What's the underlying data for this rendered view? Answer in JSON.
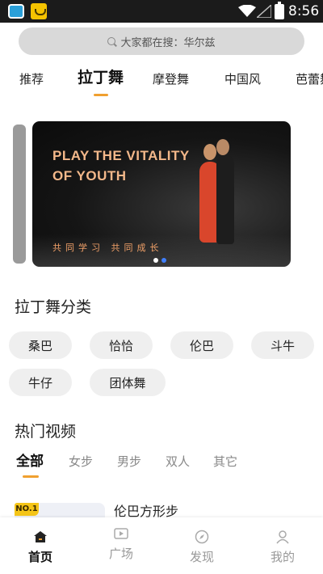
{
  "status_bar": {
    "time": "8:56",
    "icons": [
      "app-icon-blue",
      "app-icon-shopping-bag",
      "wifi-icon",
      "signal-icon",
      "battery-charging-icon"
    ]
  },
  "search": {
    "placeholder": "大家都在搜：华尔兹",
    "icon": "search-icon"
  },
  "category_tabs": [
    {
      "label": "推荐",
      "active": false
    },
    {
      "label": "拉丁舞",
      "active": true
    },
    {
      "label": "摩登舞",
      "active": false
    },
    {
      "label": "中国风",
      "active": false
    },
    {
      "label": "芭蕾舞",
      "active": false
    }
  ],
  "banner": {
    "title_line1": "PLAY THE VITALITY",
    "title_line2": "OF YOUTH",
    "subtitle": "共同学习  共同成长",
    "page_count": 2,
    "active_page": 2
  },
  "latin_categories": {
    "title": "拉丁舞分类",
    "items": [
      "桑巴",
      "恰恰",
      "伦巴",
      "斗牛",
      "牛仔",
      "团体舞"
    ]
  },
  "hot_videos": {
    "title": "热门视频",
    "tabs": [
      {
        "label": "全部",
        "active": true
      },
      {
        "label": "女步",
        "active": false
      },
      {
        "label": "男步",
        "active": false
      },
      {
        "label": "双人",
        "active": false
      },
      {
        "label": "其它",
        "active": false
      }
    ],
    "items": [
      {
        "rank_badge": "NO.1",
        "title": "伦巴方形步"
      }
    ]
  },
  "bottom_nav": [
    {
      "label": "首页",
      "icon": "home-icon",
      "active": true
    },
    {
      "label": "广场",
      "icon": "video-square-icon",
      "active": false
    },
    {
      "label": "发现",
      "icon": "compass-icon",
      "active": false
    },
    {
      "label": "我的",
      "icon": "user-icon",
      "active": false
    }
  ],
  "colors": {
    "accent": "#f0a030",
    "status_bar_bg": "#1b1b1b",
    "banner_text": "#f3b88a",
    "chip_bg": "#efefef",
    "rank_badge": "#f5c518"
  }
}
